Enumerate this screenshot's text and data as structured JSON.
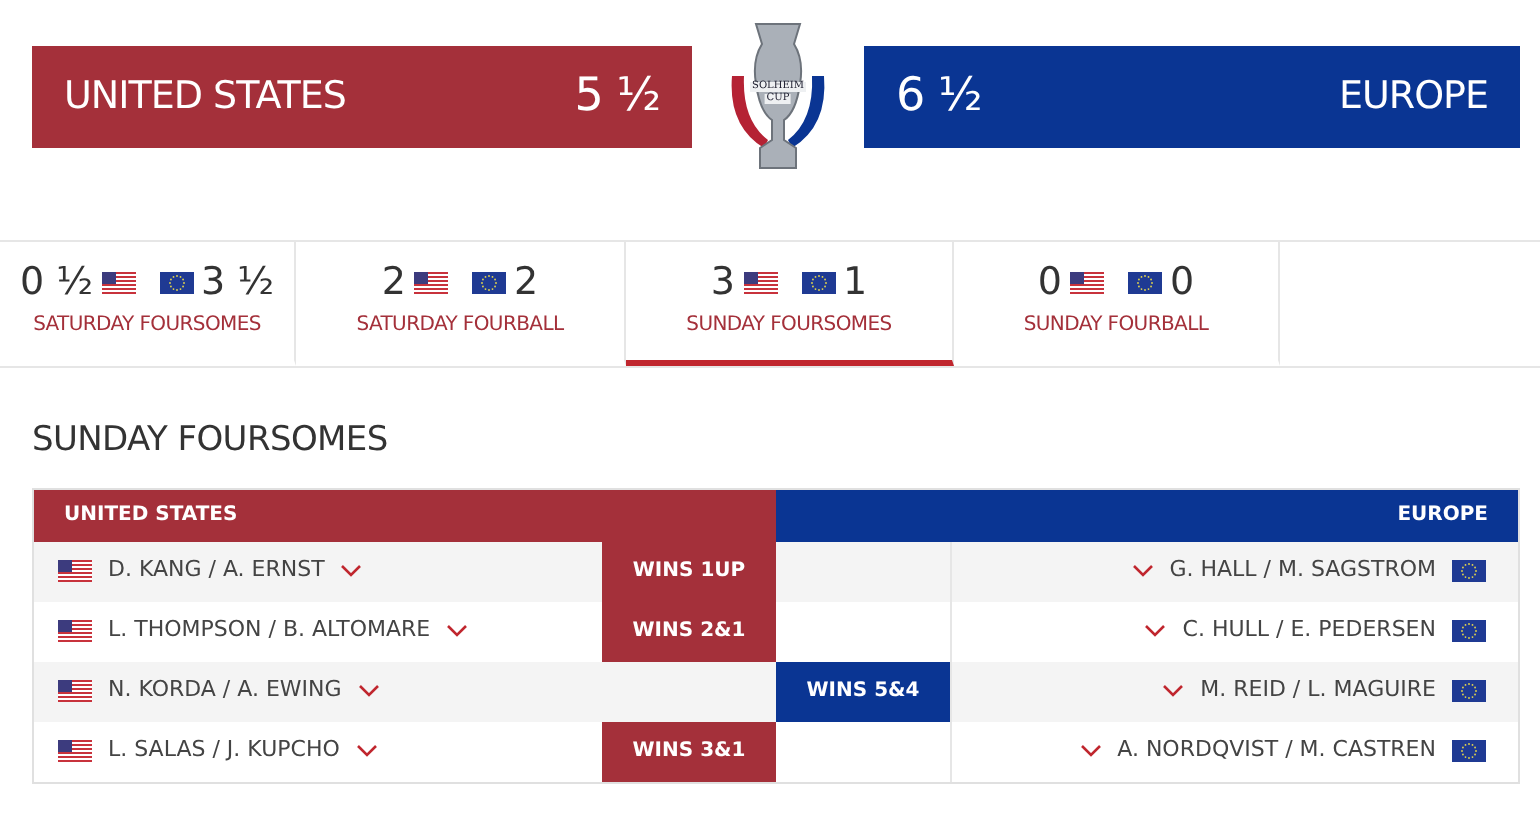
{
  "scoreboard": {
    "us": {
      "name": "UNITED STATES",
      "score": "5 ½"
    },
    "eu": {
      "name": "EUROPE",
      "score": "6 ½"
    },
    "logo_text": [
      "SOLHEIM",
      "CUP"
    ]
  },
  "tabs": [
    {
      "us_score": "0 ½",
      "eu_score": "3 ½",
      "label": "SATURDAY FOURSOMES",
      "selected": false
    },
    {
      "us_score": "2",
      "eu_score": "2",
      "label": "SATURDAY FOURBALL",
      "selected": false
    },
    {
      "us_score": "3",
      "eu_score": "1",
      "label": "SUNDAY FOURSOMES",
      "selected": true
    },
    {
      "us_score": "0",
      "eu_score": "0",
      "label": "SUNDAY FOURBALL",
      "selected": false
    }
  ],
  "section_title": "SUNDAY FOURSOMES",
  "table": {
    "us_header": "UNITED STATES",
    "eu_header": "EUROPE",
    "rows": [
      {
        "us_players": "D. KANG / A. ERNST",
        "eu_players": "G. HALL / M. SAGSTROM",
        "us_wins": true,
        "result": "WINS 1UP"
      },
      {
        "us_players": "L. THOMPSON / B. ALTOMARE",
        "eu_players": "C. HULL / E. PEDERSEN",
        "us_wins": true,
        "result": "WINS 2&1"
      },
      {
        "us_players": "N. KORDA / A. EWING",
        "eu_players": "M. REID / L. MAGUIRE",
        "us_wins": false,
        "result": "WINS 5&4"
      },
      {
        "us_players": "L. SALAS / J. KUPCHO",
        "eu_players": "A. NORDQVIST / M. CASTREN",
        "us_wins": true,
        "result": "WINS 3&1"
      }
    ]
  }
}
